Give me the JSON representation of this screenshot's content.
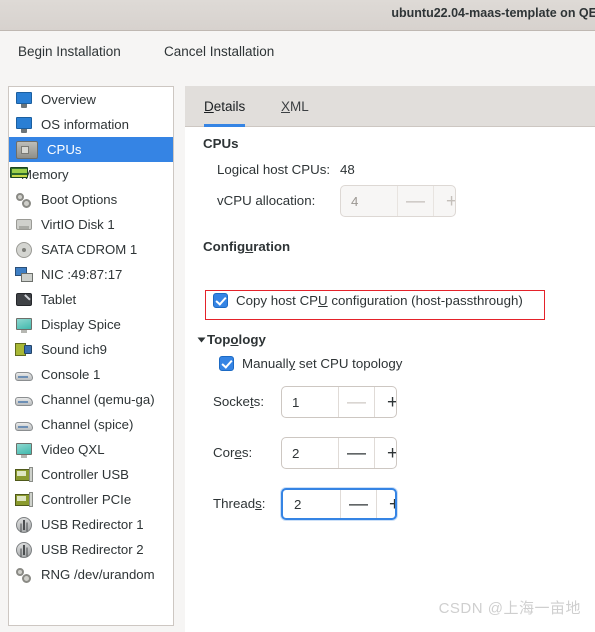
{
  "window": {
    "title": "ubuntu22.04-maas-template on QE"
  },
  "toolbar": {
    "begin_label": "Begin Installation",
    "cancel_label": "Cancel Installation"
  },
  "sidebar": {
    "items": [
      {
        "label": "Overview",
        "icon": "monitor-icon",
        "selected": false
      },
      {
        "label": "OS information",
        "icon": "monitor-icon",
        "selected": false
      },
      {
        "label": "CPUs",
        "icon": "cpu-chip-icon",
        "selected": true
      },
      {
        "label": "Memory",
        "icon": "memory-stick-icon",
        "selected": false
      },
      {
        "label": "Boot Options",
        "icon": "gears-icon",
        "selected": false
      },
      {
        "label": "VirtIO Disk 1",
        "icon": "hard-disk-icon",
        "selected": false
      },
      {
        "label": "SATA CDROM 1",
        "icon": "cdrom-icon",
        "selected": false
      },
      {
        "label": "NIC :49:87:17",
        "icon": "network-card-icon",
        "selected": false
      },
      {
        "label": "Tablet",
        "icon": "tablet-icon",
        "selected": false
      },
      {
        "label": "Display Spice",
        "icon": "display-icon",
        "selected": false
      },
      {
        "label": "Sound ich9",
        "icon": "sound-card-icon",
        "selected": false
      },
      {
        "label": "Console 1",
        "icon": "console-icon",
        "selected": false
      },
      {
        "label": "Channel (qemu-ga)",
        "icon": "console-icon",
        "selected": false
      },
      {
        "label": "Channel (spice)",
        "icon": "console-icon",
        "selected": false
      },
      {
        "label": "Video QXL",
        "icon": "display-icon",
        "selected": false
      },
      {
        "label": "Controller USB",
        "icon": "controller-card-icon",
        "selected": false
      },
      {
        "label": "Controller PCIe",
        "icon": "controller-card-icon",
        "selected": false
      },
      {
        "label": "USB Redirector 1",
        "icon": "usb-redirector-icon",
        "selected": false
      },
      {
        "label": "USB Redirector 2",
        "icon": "usb-redirector-icon",
        "selected": false
      },
      {
        "label": "RNG /dev/urandom",
        "icon": "gears-icon",
        "selected": false
      }
    ]
  },
  "tabs": {
    "details": {
      "pre": "D",
      "rest": "etails"
    },
    "xml": {
      "pre": "X",
      "rest": "ML"
    }
  },
  "cpus": {
    "section_title": "CPUs",
    "logical_host_label": "Logical host CPUs:",
    "logical_host_value": "48",
    "vcpu_label": "vCPU allocation:",
    "vcpu_value": "4",
    "minus": "—",
    "plus": "+"
  },
  "configuration": {
    "title_pre": "Config",
    "title_mn": "u",
    "title_post": "ration",
    "copy_host_pre": "Copy host CP",
    "copy_host_mn": "U",
    "copy_host_post": " configuration (host-passthrough)",
    "copy_host_checked": true,
    "highlight_color": "#e4222a"
  },
  "topology": {
    "title_pre": "Top",
    "title_mn": "o",
    "title_post": "logy",
    "expanded": true,
    "manual_pre": "Manuall",
    "manual_mn": "y",
    "manual_post": " set CPU topology",
    "manual_checked": true,
    "rows": [
      {
        "label_pre": "Socke",
        "label_mn": "t",
        "label_post": "s:",
        "value": "1",
        "minus_enabled": false,
        "focused": false
      },
      {
        "label_pre": "Cor",
        "label_mn": "e",
        "label_post": "s:",
        "value": "2",
        "minus_enabled": true,
        "focused": false
      },
      {
        "label_pre": "Thread",
        "label_mn": "s",
        "label_post": ":",
        "value": "2",
        "minus_enabled": true,
        "focused": true
      }
    ],
    "minus": "—",
    "plus": "+"
  },
  "watermark": {
    "text": "CSDN @上海一亩地"
  },
  "colors": {
    "accent": "#3584e4",
    "titlebar": "#d7d2ce",
    "toolbar": "#f6f5f4",
    "highlight": "#e4222a"
  }
}
